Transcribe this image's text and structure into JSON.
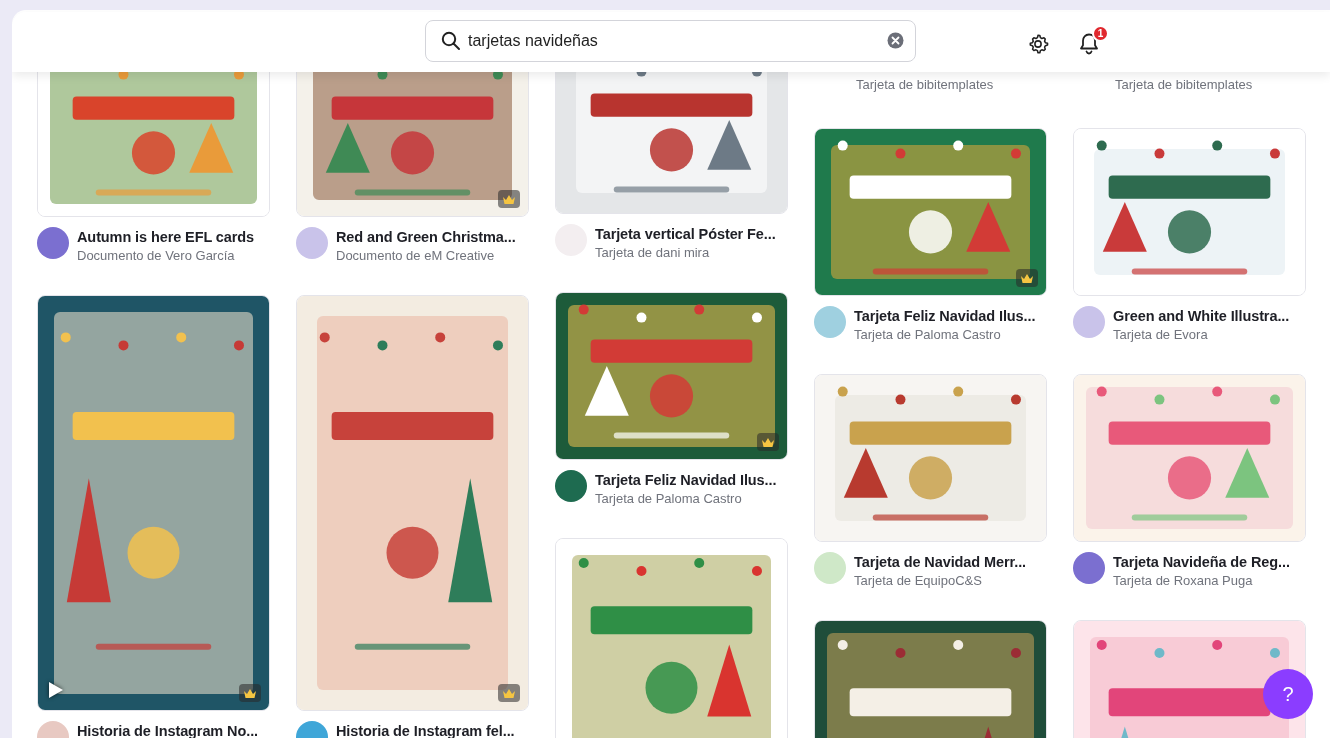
{
  "search": {
    "value": "tarjetas navideñas"
  },
  "notifications": {
    "count": "1"
  },
  "help_button": "?",
  "columns": [
    {
      "cards": [
        {
          "kind": "landscape",
          "premium": false,
          "video": false,
          "title": "Autumn is here EFL cards",
          "author": "Documento de Vero García"
        },
        {
          "kind": "story",
          "premium": true,
          "video": true,
          "title": "Historia de Instagram No..."
        }
      ]
    },
    {
      "cards": [
        {
          "kind": "landscape",
          "premium": true,
          "video": false,
          "title": "Red and Green Christma...",
          "author": "Documento de eM Creative"
        },
        {
          "kind": "story",
          "premium": true,
          "video": false,
          "title": "Historia de Instagram fel..."
        }
      ]
    },
    {
      "cards": [
        {
          "kind": "landscape",
          "premium": false,
          "video": false,
          "title": "Tarjeta vertical Póster Fe...",
          "author": "Tarjeta de dani mira"
        },
        {
          "kind": "landscape",
          "premium": true,
          "video": false,
          "title": "Tarjeta Feliz Navidad Ilus...",
          "author": "Tarjeta de Paloma Castro"
        },
        {
          "kind": "tall"
        }
      ]
    },
    {
      "cards": [
        {
          "author": "Tarjeta de bibitemplates"
        },
        {
          "kind": "landscape",
          "premium": true,
          "video": false,
          "title": "Tarjeta Feliz Navidad Ilus...",
          "author": "Tarjeta de Paloma Castro"
        },
        {
          "kind": "landscape",
          "premium": false,
          "video": false,
          "title": "Tarjeta de Navidad Merr...",
          "author": "Tarjeta de EquipoC&S"
        },
        {
          "kind": "tall"
        }
      ]
    },
    {
      "cards": [
        {
          "author": "Tarjeta de bibitemplates"
        },
        {
          "kind": "landscape",
          "premium": false,
          "video": false,
          "title": "Green and White Illustra...",
          "author": "Tarjeta de Evora"
        },
        {
          "kind": "landscape",
          "premium": false,
          "video": false,
          "title": "Tarjeta Navideña de Reg...",
          "author": "Tarjeta de Roxana Puga"
        },
        {
          "kind": "tall"
        }
      ]
    }
  ]
}
